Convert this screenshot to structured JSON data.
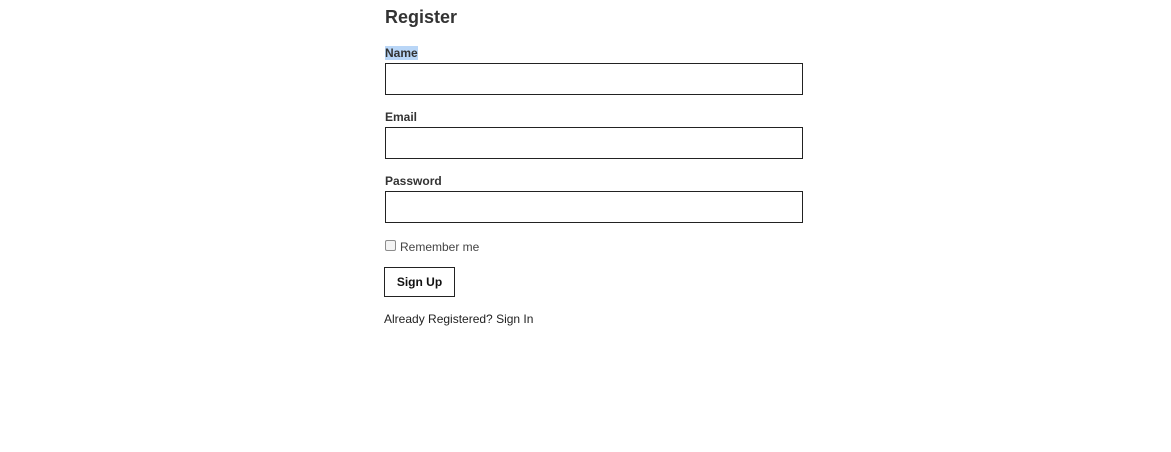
{
  "form": {
    "title": "Register",
    "fields": [
      {
        "label": "Name",
        "value": "",
        "type": "text"
      },
      {
        "label": "Email",
        "value": "",
        "type": "email"
      },
      {
        "label": "Password",
        "value": "",
        "type": "password"
      }
    ],
    "remember_label": "Remember me",
    "remember_checked": false,
    "submit_label": "Sign Up",
    "already_text": "Already Registered?",
    "signin_label": "Sign In"
  }
}
